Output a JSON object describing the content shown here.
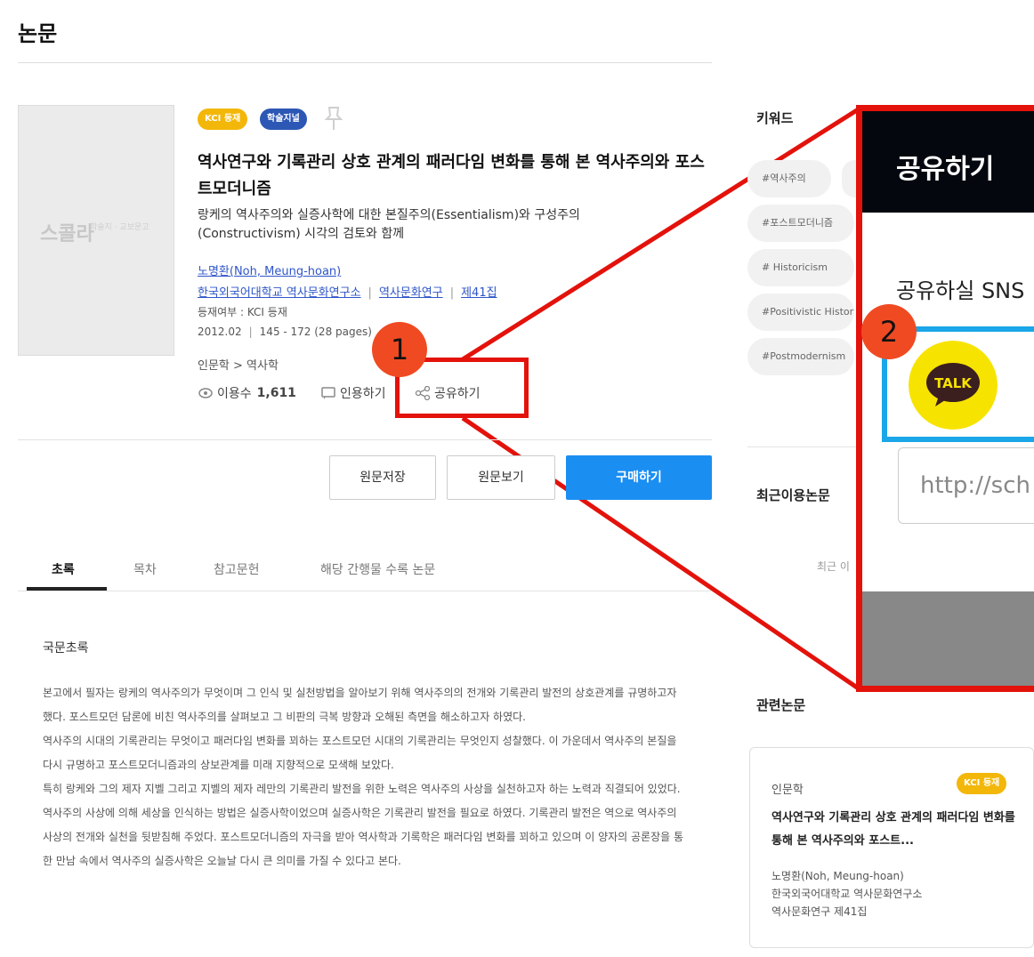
{
  "header": {
    "title": "논문"
  },
  "cover": {
    "logo": "스콜라",
    "sub": "학술지 · 교보문고"
  },
  "badges": {
    "kci": "KCI 등재",
    "journal": "학술지널"
  },
  "paper": {
    "title": "역사연구와 기록관리 상호 관계의 패러다임 변화를 통해 본 역사주의와 포스트모더니즘",
    "subtitle": "랑케의 역사주의와 실증사학에 대한 본질주의(Essentialism)와 구성주의(Constructivism) 시각의 검토와 함께",
    "author": "노명환(Noh, Meung-hoan)",
    "institution": "한국외국어대학교 역사문화연구소",
    "journal": "역사문화연구",
    "volume": "제41집",
    "kci_status": "등재여부 : KCI 등재",
    "date": "2012.02",
    "pages": "145 - 172 (28 pages)",
    "category": "인문학 > 역사학"
  },
  "stats": {
    "usage_label": "이용수",
    "usage_count": "1,611",
    "cite_label": "인용하기",
    "share_label": "공유하기"
  },
  "callouts": {
    "one": "1",
    "two": "2"
  },
  "buttons": {
    "save": "원문저장",
    "view": "원문보기",
    "buy": "구매하기"
  },
  "tabs": [
    "초록",
    "목차",
    "참고문헌",
    "해당 간행물 수록 논문"
  ],
  "abstract": {
    "heading": "국문초록",
    "body": "본고에서 필자는 랑케의 역사주의가 무엇이며 그 인식 및 실천방법을 알아보기 위해 역사주의의 전개와 기록관리 발전의 상호관계를 규명하고자 했다. 포스트모던 담론에 비친 역사주의를 살펴보고 그 비판의 극복 방향과 오해된 측면을 해소하고자 하였다.\n역사주의 시대의 기록관리는 무엇이고 패러다임 변화를 꾀하는 포스트모던 시대의 기록관리는 무엇인지 성찰했다. 이 가운데서 역사주의 본질을 다시 규명하고 포스트모더니즘과의 상보관계를 미래 지향적으로 모색해 보았다.\n특히 랑케와 그의 제자 지벨 그리고 지벨의 제자 레만의 기록관리 발전을 위한 노력은 역사주의 사상을 실천하고자 하는 노력과 직결되어 있었다. 역사주의 사상에 의해 세상을 인식하는 방법은 실증사학이었으며 실증사학은 기록관리 발전을 필요로 하였다. 기록관리 발전은 역으로 역사주의 사상의 전개와 실천을 뒷받침해 주었다. 포스트모더니즘의 자극을 받아 역사학과 기록학은 패러다임 변화를 꾀하고 있으며 이 양자의 공론장을 통한 만남 속에서 역사주의 실증사학은 오늘날 다시 큰 의미를 가질 수 있다고 본다."
  },
  "sidebar": {
    "keywords_label": "키워드",
    "keywords": [
      "#역사주의",
      "",
      "#포스트모더니즘",
      "# Historicism",
      "#Positivistic History",
      "#Postmodernism"
    ],
    "recent_label": "최근이용논문",
    "recent_empty": "최근 이",
    "related_label": "관련논문",
    "related": {
      "category": "인문학",
      "badge": "KCI 등재",
      "title": "역사연구와 기록관리 상호 관계의 패러다임 변화를 통해 본 역사주의와 포스트...",
      "author": "노명환(Noh, Meung-hoan)",
      "institution": "한국외국어대학교 역사문화연구소",
      "journal": "역사문화연구 제41집"
    }
  },
  "share_popup": {
    "title": "공유하기",
    "prompt": "공유하실 SNS",
    "kakao": "TALK",
    "url": "http://sch"
  },
  "colors": {
    "accent": "#1b8ef2",
    "callout": "#e3120b",
    "kci": "#f3b70a",
    "kakao": "#f7e300"
  }
}
